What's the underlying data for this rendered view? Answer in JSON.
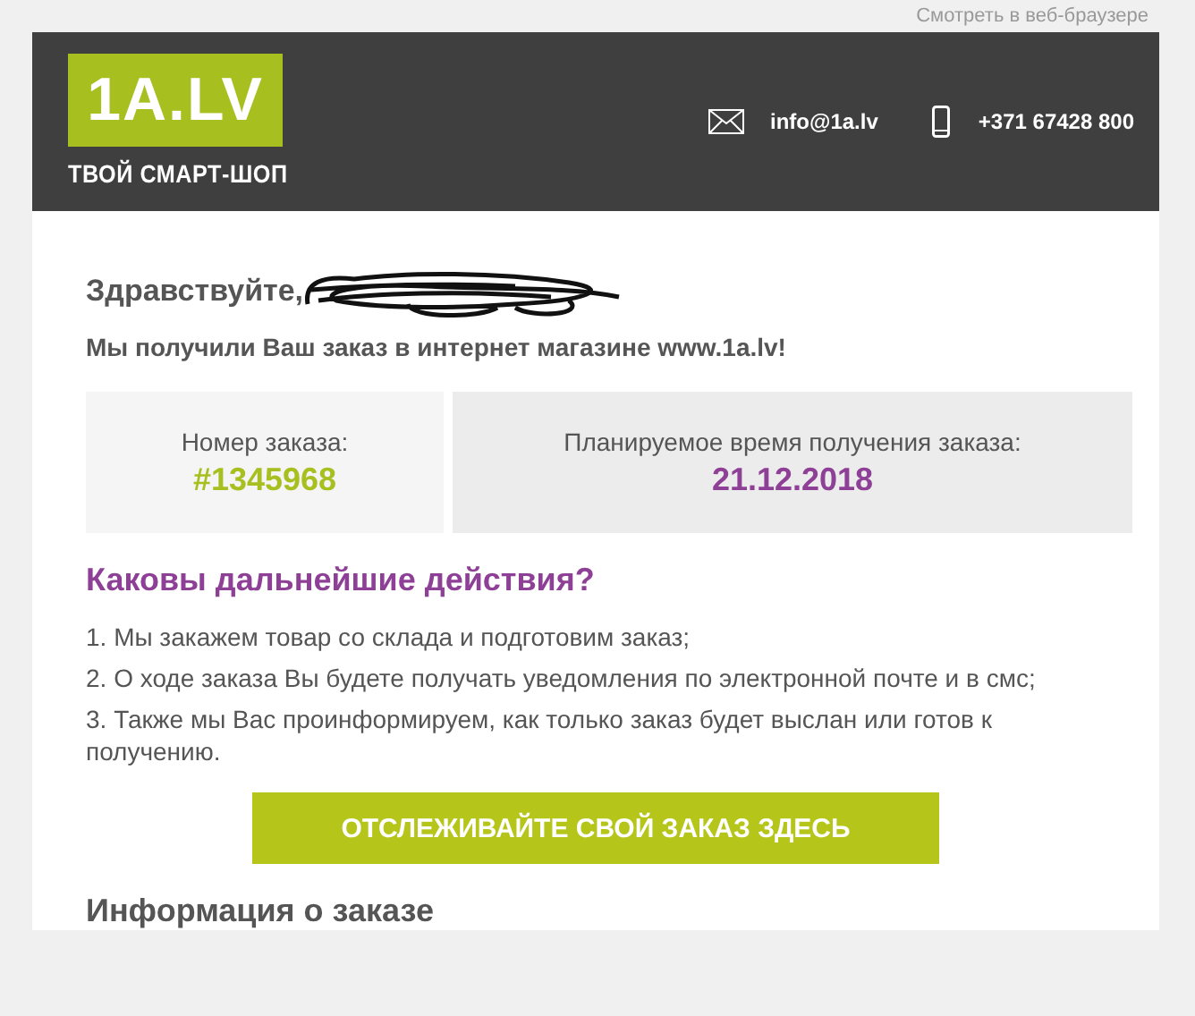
{
  "browser_link": "Смотреть в веб-браузере",
  "header": {
    "logo": "1A.LV",
    "tagline": "ТВОЙ СМАРТ-ШОП",
    "email": "info@1a.lv",
    "phone": "+371 67428 800"
  },
  "greeting": "Здравствуйте,",
  "intro": "Мы получили Ваш заказ в интернет магазине www.1a.lv!",
  "order": {
    "number_label": "Номер заказа:",
    "number": "#1345968",
    "date_label": "Планируемое время получения заказа:",
    "date": "21.12.2018"
  },
  "next_steps": {
    "title": "Каковы дальнейшие действия?",
    "items": [
      "1. Мы закажем товар со склада и подготовим заказ;",
      "2. О ходе заказа Вы будете получать уведомления по электронной почте и в смс;",
      "3. Также мы Вас проинформируем, как только заказ будет выслан или готов к получению."
    ]
  },
  "track_button": "ОТСЛЕЖИВАЙТЕ СВОЙ ЗАКАЗ ЗДЕСЬ",
  "order_info_title": "Информация о заказе"
}
